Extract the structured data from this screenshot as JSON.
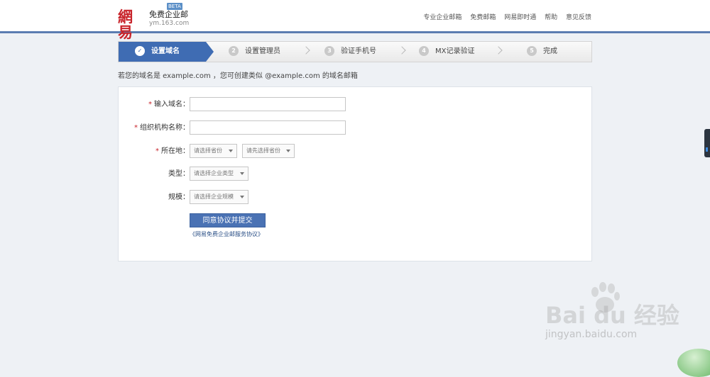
{
  "header": {
    "logo_mark": "網易",
    "logo_name": "免费企业邮",
    "logo_beta": "BETA",
    "logo_domain": "ym.163.com",
    "nav": [
      "专业企业邮箱",
      "免费邮箱",
      "网易即时通",
      "帮助",
      "意见反馈"
    ]
  },
  "steps": [
    {
      "num": "✓",
      "label": "设置域名"
    },
    {
      "num": "2",
      "label": "设置管理员"
    },
    {
      "num": "3",
      "label": "验证手机号"
    },
    {
      "num": "4",
      "label": "MX记录验证"
    },
    {
      "num": "5",
      "label": "完成"
    }
  ],
  "hint": "若您的域名是 example.com ，您可创建类似 @example.com 的域名邮箱",
  "form": {
    "required_mark": "*",
    "domain_label": "输入域名：",
    "domain_value": "",
    "org_label": "组织机构名称：",
    "org_value": "",
    "location_label": "所在地：",
    "province_select": "请选择省份",
    "city_select": "请先选择省份",
    "type_label": "类型：",
    "type_select": "请选择企业类型",
    "scale_label": "规模：",
    "scale_select": "请选择企业规模",
    "submit_label": "同意协议并提交",
    "agreement_link": "《网易免费企业邮服务协议》"
  },
  "watermark": {
    "brand": "Bai du 经验",
    "url": "jingyan.baidu.com"
  },
  "colors": {
    "accent": "#3f6cb3",
    "required": "#c8242b",
    "logo": "#c8242b"
  }
}
